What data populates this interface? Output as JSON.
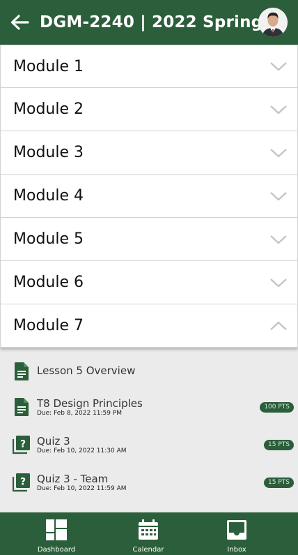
{
  "header": {
    "title": "DGM-2240 | 2022 Spring",
    "back_icon": "arrow-left-icon",
    "avatar_icon": "user-avatar"
  },
  "modules": [
    {
      "label": "Module 1",
      "expanded": false
    },
    {
      "label": "Module 2",
      "expanded": false
    },
    {
      "label": "Module 3",
      "expanded": false
    },
    {
      "label": "Module 4",
      "expanded": false
    },
    {
      "label": "Module 5",
      "expanded": false
    },
    {
      "label": "Module 6",
      "expanded": false
    },
    {
      "label": "Module 7",
      "expanded": true
    }
  ],
  "module7_items": [
    {
      "title": "Lesson 5 Overview",
      "due": "",
      "points": "",
      "icon": "document-icon"
    },
    {
      "title": "T8 Design Principles",
      "due": "Due: Feb 8, 2022 11:59 PM",
      "points": "100 PTS",
      "icon": "document-icon"
    },
    {
      "title": "Quiz 3",
      "due": "Due: Feb 10, 2022 11:30 AM",
      "points": "15 PTS",
      "icon": "quiz-icon"
    },
    {
      "title": "Quiz 3 - Team",
      "due": "Due: Feb 10, 2022 11:59 AM",
      "points": "15 PTS",
      "icon": "quiz-icon"
    }
  ],
  "tabbar": [
    {
      "label": "Dashboard",
      "icon": "dashboard-icon"
    },
    {
      "label": "Calendar",
      "icon": "calendar-icon"
    },
    {
      "label": "Inbox",
      "icon": "inbox-icon"
    }
  ],
  "colors": {
    "primary_green": "#2b5e3a",
    "background": "#ebebeb",
    "chevron": "#c4c4c4"
  }
}
